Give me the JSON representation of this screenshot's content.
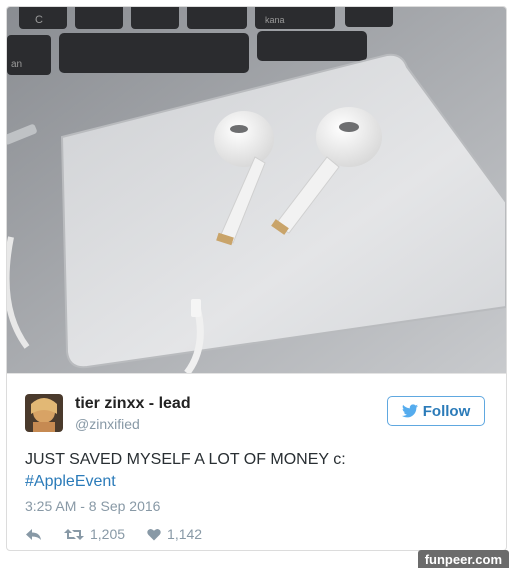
{
  "photo": {
    "description_icon": "earpods-on-trackpad-photo",
    "key_labels": [
      "C",
      "an",
      "kana"
    ]
  },
  "user": {
    "display_name": "tier zinxx - lead",
    "handle": "@zinxified",
    "avatar_icon": "user-avatar"
  },
  "follow_button": {
    "label": "Follow",
    "icon": "twitter-bird-icon",
    "color": "#2b7bb9"
  },
  "tweet": {
    "text": "JUST SAVED MYSELF A LOT OF MONEY c:",
    "hashtag": "#AppleEvent",
    "timestamp": "3:25 AM - 8 Sep 2016"
  },
  "actions": {
    "reply_icon": "reply-icon",
    "retweet_icon": "retweet-icon",
    "retweets": "1,205",
    "like_icon": "heart-icon",
    "likes": "1,142"
  },
  "watermark": "funpeer.com"
}
